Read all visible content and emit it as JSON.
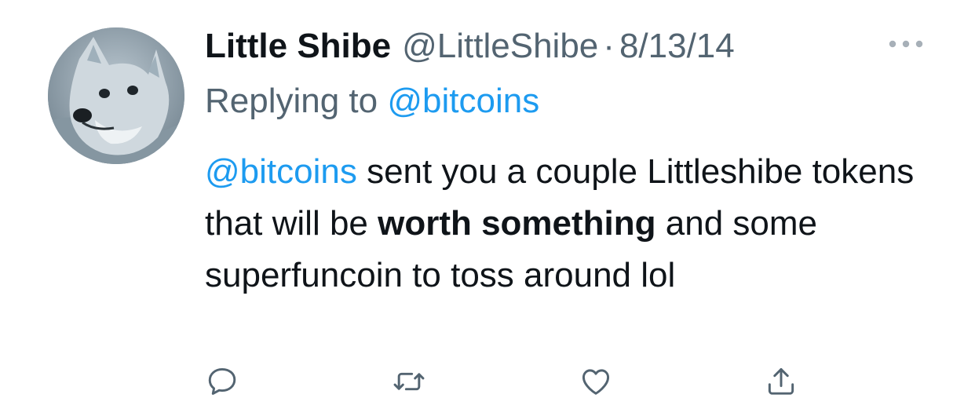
{
  "tweet": {
    "display_name": "Little Shibe",
    "handle": "@LittleShibe",
    "separator": "·",
    "date": "8/13/14",
    "replying_prefix": "Replying to",
    "replying_to": "@bitcoins",
    "body": {
      "mention": "@bitcoins",
      "text_1": " sent you a couple Littleshibe tokens that will be ",
      "bold": "worth something",
      "text_2": " and some superfuncoin to toss around lol"
    }
  },
  "actions": {
    "icons": [
      "reply-icon",
      "retweet-icon",
      "like-icon",
      "share-icon"
    ]
  },
  "colors": {
    "text": "#0f1419",
    "secondary": "#536471",
    "link": "#1d9bf0",
    "background": "#ffffff"
  }
}
